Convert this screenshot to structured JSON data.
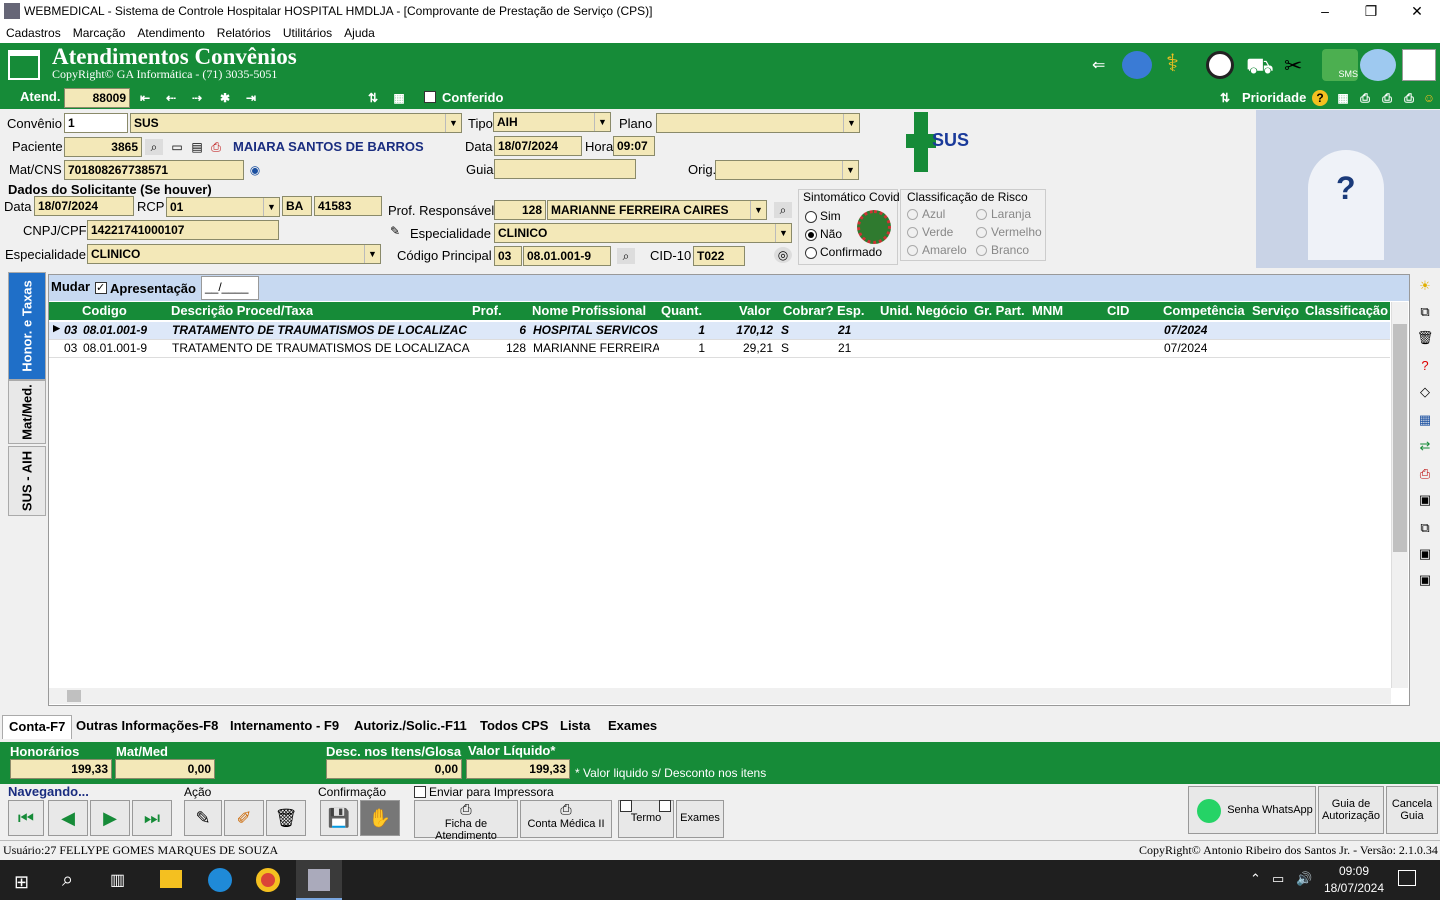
{
  "window": {
    "title": "WEBMEDICAL - Sistema de Controle Hospitalar HOSPITAL HMDLJA - [Comprovante de Prestação de Serviço  (CPS)]"
  },
  "menu": [
    "Cadastros",
    "Marcação",
    "Atendimento",
    "Relatórios",
    "Utilitários",
    "Ajuda"
  ],
  "banner": {
    "title": "Atendimentos Convênios",
    "copyright": "CopyRight© GA Informática - (71) 3035-5051"
  },
  "toolbar": {
    "atend_label": "Atend.",
    "atend_value": "88009",
    "conferido": "Conferido",
    "prioridade": "Prioridade"
  },
  "form": {
    "convenio_label": "Convênio",
    "convenio_code": "1",
    "convenio_name": "SUS",
    "tipo_label": "Tipo",
    "tipo_value": "AIH",
    "plano_label": "Plano",
    "plano_value": "",
    "paciente_label": "Paciente",
    "paciente_code": "3865",
    "paciente_name": "MAIARA SANTOS DE BARROS",
    "data_label": "Data",
    "data_value": "18/07/2024",
    "hora_label": "Hora",
    "hora_value": "09:07",
    "matcns_label": "Mat/CNS",
    "matcns_value": "701808267738571",
    "guia_label": "Guia",
    "guia_value": "",
    "orig_label": "Orig.",
    "orig_value": "",
    "solicitante_title": "Dados do Solicitante (Se houver)",
    "sol_data_label": "Data",
    "sol_data_value": "18/07/2024",
    "rcp_label": "RCP",
    "rcp_value": "01",
    "uf_value": "BA",
    "crm_value": "41583",
    "cnpj_label": "CNPJ/CPF",
    "cnpj_value": "14221741000107",
    "esp_label": "Especialidade",
    "esp_value": "CLINICO",
    "prof_label": "Prof. Responsável",
    "prof_code": "128",
    "prof_name": "MARIANNE FERREIRA CAIRES",
    "esp2_label": "Especialidade",
    "esp2_value": "CLINICO",
    "codprinc_label": "Código Principal",
    "codprinc_a": "03",
    "codprinc_b": "08.01.001-9",
    "cid_label": "CID-10",
    "cid_value": "T022",
    "sintomatico_title": "Sintomático Covid",
    "sint_opts": [
      "Sim",
      "Não",
      "Confirmado"
    ],
    "risco_title": "Classificação de Risco",
    "risco_opts": [
      "Azul",
      "Laranja",
      "Verde",
      "Vermelho",
      "Amarelo",
      "Branco"
    ]
  },
  "grid": {
    "mudar": "Mudar",
    "apresentacao": "Apresentação",
    "apresentacao_value": "__/____",
    "headers": [
      "Codigo",
      "Descrição Proced/Taxa",
      "Prof.",
      "Nome Profissional",
      "Quant.",
      "Valor",
      "Cobrar?",
      "Esp.",
      "Unid. Negócio",
      "Gr. Part.",
      "MNM",
      "CID",
      "Competência",
      "Serviço",
      "Classificação"
    ],
    "rows": [
      {
        "g": "03",
        "codigo": "08.01.001-9",
        "desc": "TRATAMENTO DE TRAUMATISMOS DE LOCALIZAC",
        "prof": "6",
        "nome": "HOSPITAL SERVICOS",
        "quant": "1",
        "valor": "170,12",
        "cobrar": "S",
        "esp": "21",
        "comp": "07/2024"
      },
      {
        "g": "03",
        "codigo": "08.01.001-9",
        "desc": "TRATAMENTO DE TRAUMATISMOS DE LOCALIZACAO",
        "prof": "128",
        "nome": "MARIANNE FERREIRA",
        "quant": "1",
        "valor": "29,21",
        "cobrar": "S",
        "esp": "21",
        "comp": "07/2024"
      }
    ]
  },
  "vtabs": [
    "Honor. e Taxas",
    "Mat/Med.",
    "SUS - AIH"
  ],
  "btabs": [
    "Conta-F7",
    "Outras Informações-F8",
    "Internamento - F9",
    "Autoriz./Solic.-F11",
    "Todos CPS",
    "Lista",
    "Exames"
  ],
  "totals": {
    "hon_label": "Honorários",
    "hon_value": "199,33",
    "mat_label": "Mat/Med",
    "mat_value": "0,00",
    "desc_label": "Desc. nos Itens/Glosa",
    "desc_value": "0,00",
    "liq_label": "Valor Líquido*",
    "liq_value": "199,33",
    "note": "* Valor liquido s/ Desconto nos itens"
  },
  "bottom": {
    "navegando": "Navegando...",
    "acao": "Ação",
    "confirmacao": "Confirmação",
    "enviar": "Enviar para Impressora",
    "ficha": "Ficha de Atendimento",
    "conta": "Conta Médica II",
    "termo": "Termo",
    "exames": "Exames",
    "whats": "Senha WhatsApp",
    "guia": "Guia de Autorização",
    "cancela": "Cancela Guia"
  },
  "status": {
    "user": "Usuário:27 FELLYPE GOMES MARQUES DE SOUZA",
    "version": "CopyRight© Antonio Ribeiro dos Santos Jr. - Versão: 2.1.0.34"
  },
  "clock": {
    "time": "09:09",
    "date": "18/07/2024"
  }
}
